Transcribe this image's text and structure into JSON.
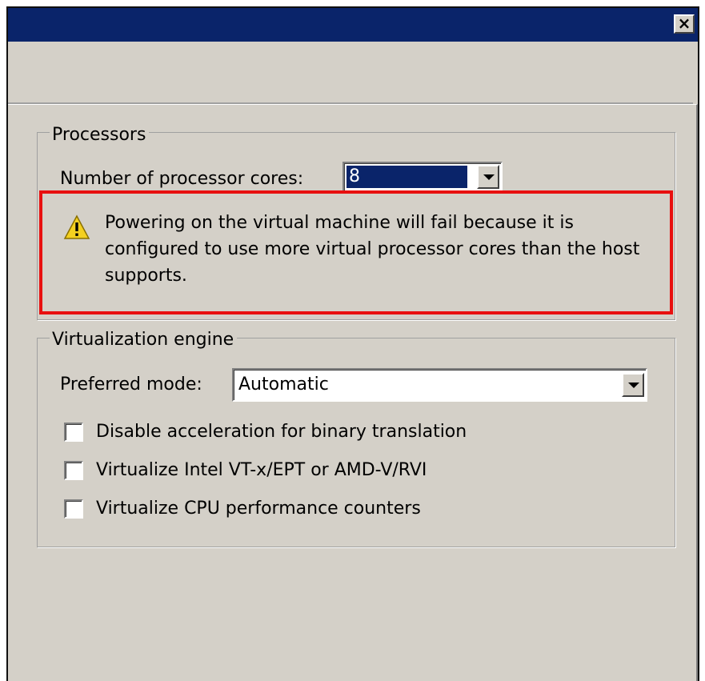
{
  "window": {
    "close_label": "✕"
  },
  "processors": {
    "legend": "Processors",
    "cores_label": "Number of processor cores:",
    "cores_value": "8",
    "warning_text": "Powering on the virtual machine will fail because it is configured to use more virtual processor cores than the host supports."
  },
  "virtualization": {
    "legend": "Virtualization engine",
    "mode_label": "Preferred mode:",
    "mode_value": "Automatic",
    "options": [
      {
        "label": "Disable acceleration for binary translation",
        "checked": false
      },
      {
        "label": "Virtualize Intel VT-x/EPT or AMD-V/RVI",
        "checked": false
      },
      {
        "label": "Virtualize CPU performance counters",
        "checked": false
      }
    ]
  },
  "colors": {
    "titlebar": "#0a246a",
    "dialog_face": "#d4d0c8",
    "highlight_box": "#e81010",
    "warning_icon": "#f4d020"
  },
  "icons": {
    "warning": "warning-triangle-icon",
    "dropdown": "chevron-down-icon",
    "close": "close-icon"
  }
}
